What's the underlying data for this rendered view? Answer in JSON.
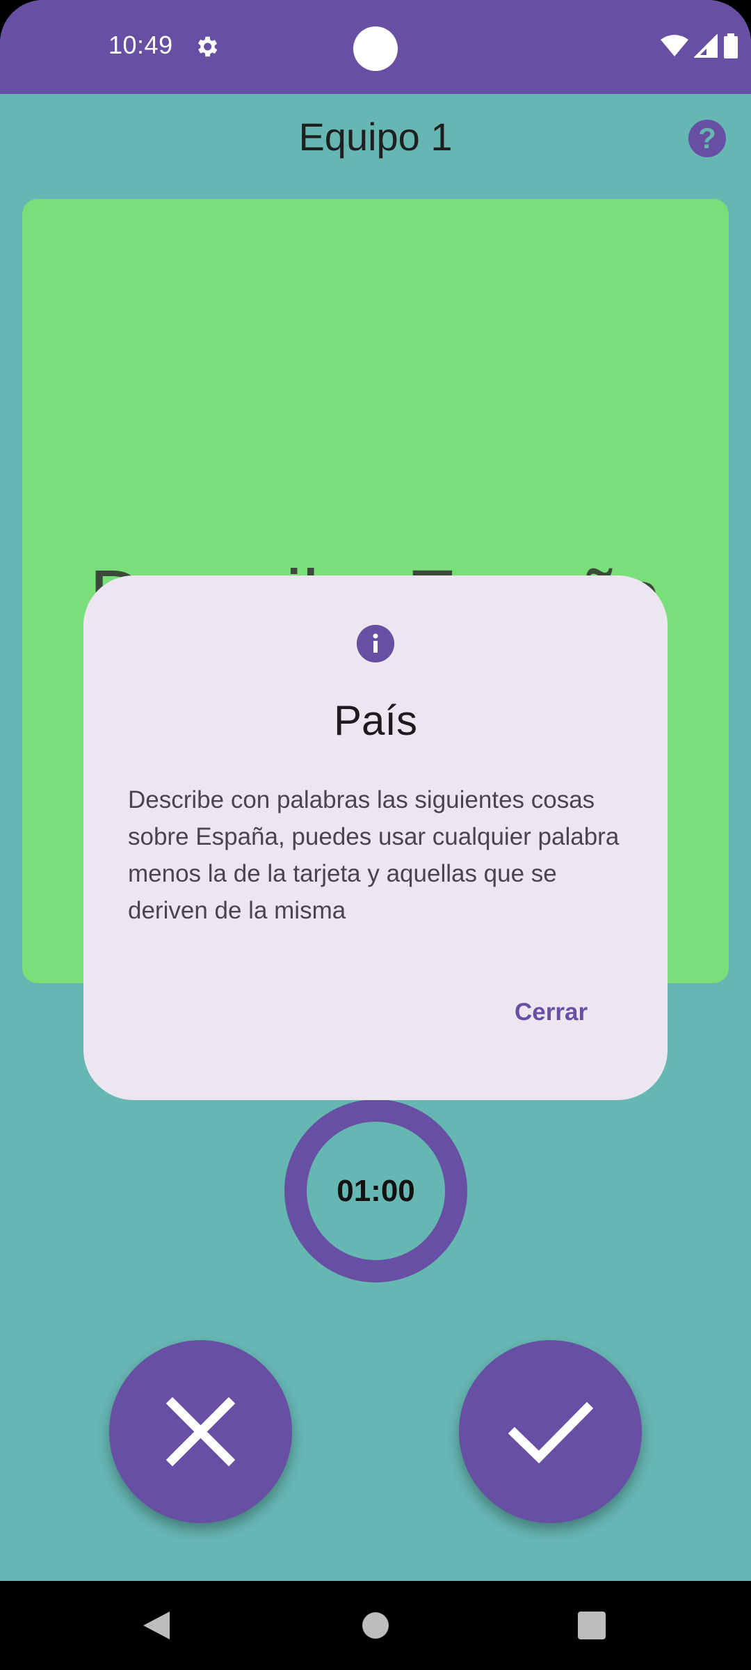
{
  "status_bar": {
    "time": "10:49",
    "icons": [
      "gear-icon",
      "wifi-icon",
      "signal-icon",
      "battery-icon"
    ],
    "color": "#6750a4"
  },
  "header": {
    "title": "Equipo 1",
    "help_icon": "help-icon",
    "help_glyph": "?"
  },
  "card": {
    "word": "Describe España",
    "color": "#7ade79"
  },
  "timer": {
    "time": "01:00"
  },
  "actions": {
    "reject_icon": "close-icon",
    "accept_icon": "check-icon"
  },
  "dialog": {
    "icon": "info-icon",
    "title": "País",
    "body": "Describe con palabras las siguientes cosas sobre España, puedes usar cualquier palabra menos la de la tarjeta y aquellas que se deriven de la misma",
    "close_label": "Cerrar"
  },
  "nav": {
    "items": [
      "back-icon",
      "home-icon",
      "recents-icon"
    ]
  },
  "colors": {
    "background": "#66b6b2",
    "accent": "#6750a4",
    "dialog_surface": "#ece6f0"
  }
}
